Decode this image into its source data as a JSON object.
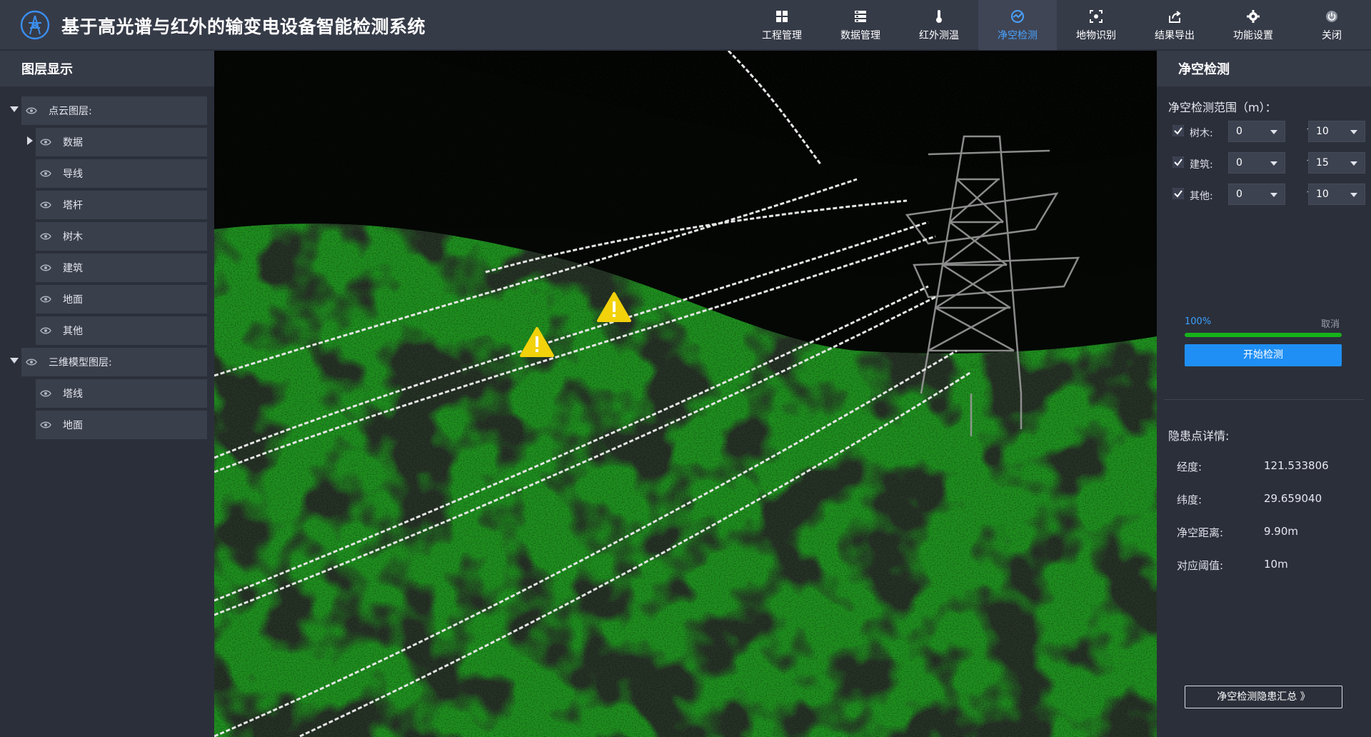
{
  "app": {
    "title": "基于高光谱与红外的输变电设备智能检测系统",
    "logo_icon": "power-tower-logo-icon"
  },
  "nav": [
    {
      "label": "工程管理",
      "icon": "grid-icon",
      "active": false
    },
    {
      "label": "数据管理",
      "icon": "list-icon",
      "active": false
    },
    {
      "label": "红外测温",
      "icon": "thermometer-icon",
      "active": false
    },
    {
      "label": "净空检测",
      "icon": "clearance-scan-icon",
      "active": true
    },
    {
      "label": "地物识别",
      "icon": "object-recognition-icon",
      "active": false
    },
    {
      "label": "结果导出",
      "icon": "export-icon",
      "active": false
    },
    {
      "label": "功能设置",
      "icon": "gear-icon",
      "active": false
    },
    {
      "label": "关闭",
      "icon": "power-icon",
      "active": false
    }
  ],
  "layers": {
    "title": "图层显示",
    "point_cloud": {
      "label": "点云图层:",
      "items": [
        "数据",
        "导线",
        "塔杆",
        "树木",
        "建筑",
        "地面",
        "其他"
      ]
    },
    "model_3d": {
      "label": "三维模型图层:",
      "items": [
        "塔线",
        "地面"
      ]
    }
  },
  "clearance": {
    "title": "净空检测",
    "range_label": "净空检测范围（m）：",
    "ranges": [
      {
        "name": "树木:",
        "checked": true,
        "min": "0",
        "max": "10"
      },
      {
        "name": "建筑:",
        "checked": true,
        "min": "0",
        "max": "15"
      },
      {
        "name": "其他:",
        "checked": true,
        "min": "0",
        "max": "10"
      }
    ],
    "tilde": "~",
    "progress_text": "100%",
    "progress_value": 1.0,
    "cancel_label": "取消",
    "start_label": "开始检测",
    "details_title": "隐患点详情:",
    "details": [
      {
        "label": "经度:",
        "value": "121.533806"
      },
      {
        "label": "纬度:",
        "value": "29.659040"
      },
      {
        "label": "净空距离:",
        "value": "9.90m"
      },
      {
        "label": "对应阈值:",
        "value": "10m"
      }
    ],
    "summary_label": "净空检测隐患汇总 》"
  },
  "viewport": {
    "warning_icon": "warning-triangle-icon",
    "colors": {
      "vegetation": "#1f8f1f",
      "wires": "#e8e8e8",
      "tower": "#a0a0a0",
      "background": "#060806",
      "warning": "#f2d20a",
      "accent": "#1f8ff5"
    }
  }
}
